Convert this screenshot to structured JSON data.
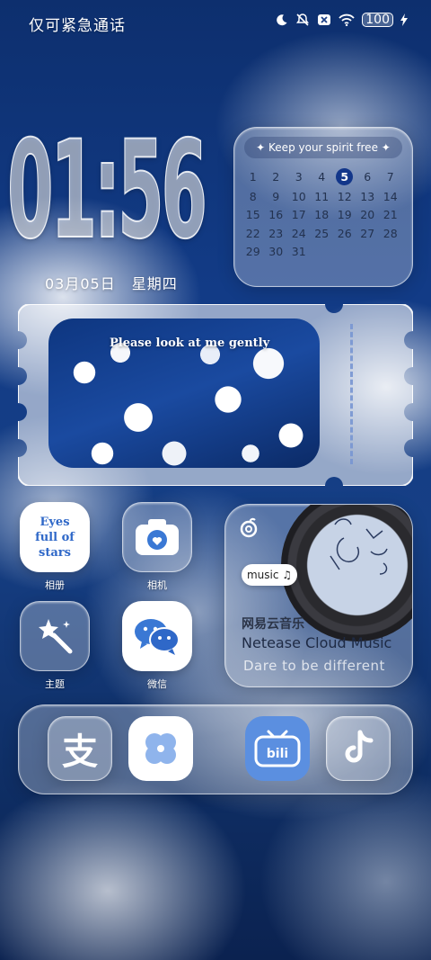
{
  "status_bar": {
    "carrier_text": "仅可紧急通话",
    "battery": "100"
  },
  "clock": {
    "time": "01:56",
    "date": "03月05日",
    "weekday": "星期四"
  },
  "calendar": {
    "header": "Keep your spirit free",
    "days": [
      "1",
      "2",
      "3",
      "4",
      "5",
      "6",
      "7",
      "8",
      "9",
      "10",
      "11",
      "12",
      "13",
      "14",
      "15",
      "16",
      "17",
      "18",
      "19",
      "20",
      "21",
      "22",
      "23",
      "24",
      "25",
      "26",
      "27",
      "28",
      "29",
      "30",
      "31"
    ],
    "today": "5"
  },
  "photo_widget": {
    "caption": "Please look at me gently"
  },
  "apps": {
    "album": {
      "label": "相册",
      "icon_text": [
        "Eyes",
        "full of",
        "stars"
      ]
    },
    "camera": {
      "label": "相机"
    },
    "theme": {
      "label": "主题"
    },
    "wechat": {
      "label": "微信"
    }
  },
  "music_widget": {
    "pill": "music",
    "title_cn": "网易云音乐",
    "title_en": "Netease Cloud Music",
    "tagline": "Dare to be different"
  },
  "dock": {
    "alipay_glyph": "支",
    "items": [
      "alipay",
      "clover",
      "bilibili",
      "tiktok"
    ]
  },
  "colors": {
    "accent": "#12368a",
    "album_blue": "#2f68c8",
    "bilibili_blue": "#5b8fe0"
  }
}
